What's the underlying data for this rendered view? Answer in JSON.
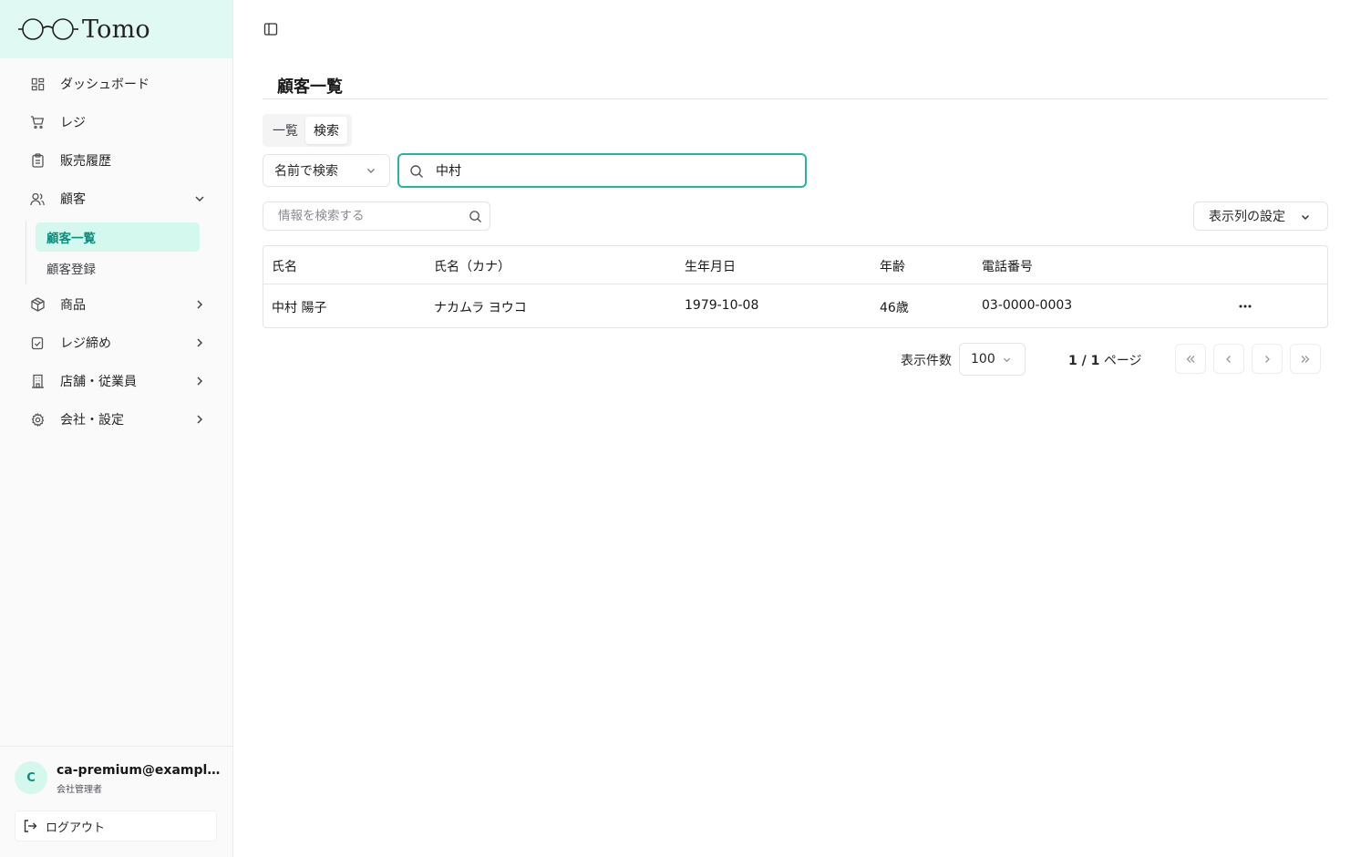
{
  "app": {
    "logo_text": "Tomo"
  },
  "sidebar": {
    "items": [
      {
        "label": "ダッシュボード"
      },
      {
        "label": "レジ"
      },
      {
        "label": "販売履歴"
      },
      {
        "label": "顧客"
      },
      {
        "label": "商品"
      },
      {
        "label": "レジ締め"
      },
      {
        "label": "店舗・従業員"
      },
      {
        "label": "会社・設定"
      }
    ],
    "sub_items": [
      {
        "label": "顧客一覧"
      },
      {
        "label": "顧客登録"
      }
    ]
  },
  "user": {
    "avatar_initial": "C",
    "email": "ca-premium@example....",
    "role": "会社管理者",
    "logout_label": "ログアウト"
  },
  "main": {
    "title": "顧客一覧",
    "tabs": [
      {
        "label": "一覧"
      },
      {
        "label": "検索"
      }
    ],
    "search_field_select": "名前で検索",
    "search_value": "中村",
    "info_search_placeholder": "情報を検索する",
    "column_settings_label": "表示列の設定"
  },
  "table": {
    "headers": [
      "氏名",
      "氏名（カナ）",
      "生年月日",
      "年齢",
      "電話番号"
    ],
    "rows": [
      {
        "name": "中村 陽子",
        "kana": "ナカムラ ヨウコ",
        "birthdate": "1979-10-08",
        "age": "46歳",
        "phone": "03-0000-0003"
      }
    ]
  },
  "pagination": {
    "page_size_label": "表示件数",
    "page_size": "100",
    "page_current": "1",
    "page_sep": " / ",
    "page_total": "1",
    "page_suffix": " ページ"
  },
  "colors": {
    "accent": "#26b5a0",
    "accent_bg": "#d4f7ee",
    "logo_bg": "#e0f9f3"
  }
}
